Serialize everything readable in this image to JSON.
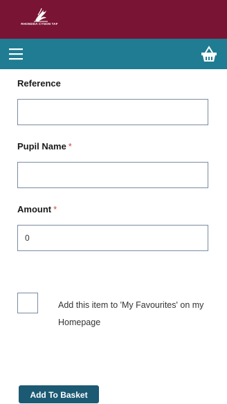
{
  "header": {
    "logo_text": "RHONDDA CYNON TAF",
    "brand_color": "#7a1434",
    "nav_color": "#1f7c92",
    "menu_icon": "hamburger-menu-icon",
    "basket_icon": "basket-icon"
  },
  "form": {
    "reference": {
      "label": "Reference",
      "value": ""
    },
    "pupil_name": {
      "label": "Pupil Name",
      "required_mark": "*",
      "value": ""
    },
    "amount": {
      "label": "Amount",
      "required_mark": "*",
      "value": "0"
    },
    "favourites": {
      "label": "Add this item to 'My Favourites' on my Homepage",
      "checked": false
    },
    "submit_label": "Add To Basket",
    "button_color": "#1c5a73"
  }
}
